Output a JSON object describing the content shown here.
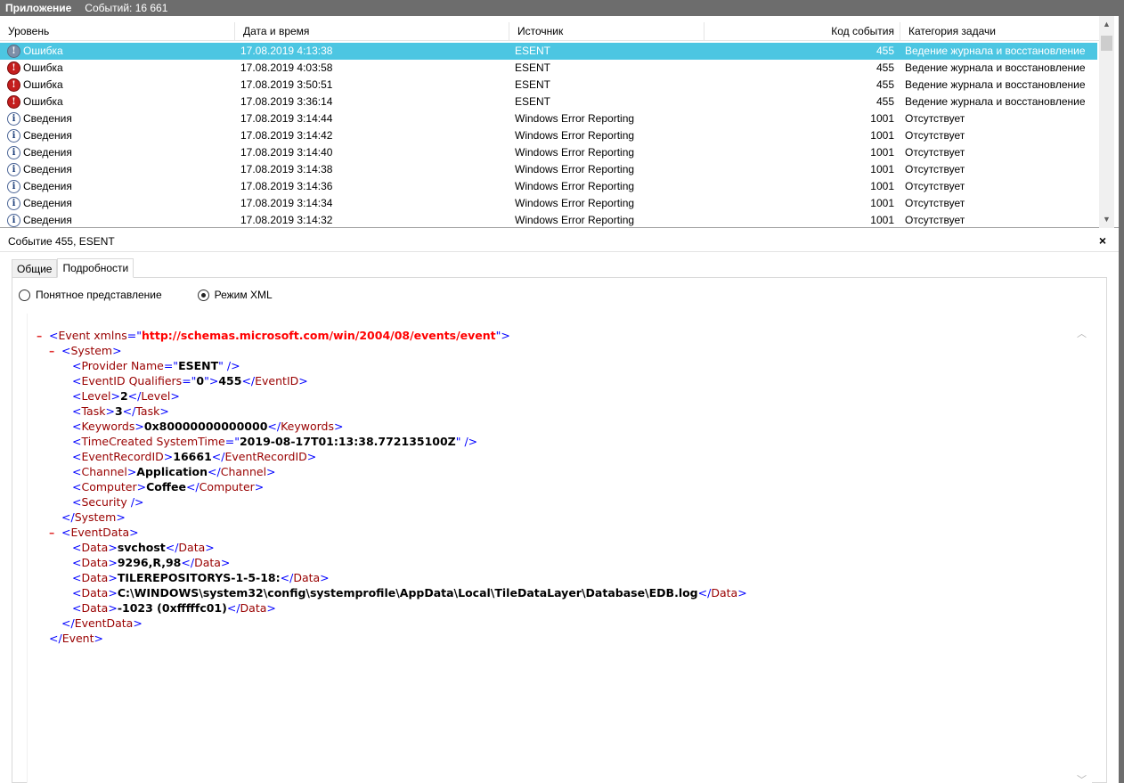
{
  "titlebar": {
    "app": "Приложение",
    "events": "Событий: 16 661"
  },
  "list": {
    "columns": {
      "level": "Уровень",
      "date": "Дата и время",
      "source": "Источник",
      "code": "Код события",
      "category": "Категория задачи"
    },
    "rows": [
      {
        "level": "Ошибка",
        "date": "17.08.2019 4:13:38",
        "source": "ESENT",
        "code": "455",
        "category": "Ведение журнала и восстановление"
      },
      {
        "level": "Ошибка",
        "date": "17.08.2019 4:03:58",
        "source": "ESENT",
        "code": "455",
        "category": "Ведение журнала и восстановление"
      },
      {
        "level": "Ошибка",
        "date": "17.08.2019 3:50:51",
        "source": "ESENT",
        "code": "455",
        "category": "Ведение журнала и восстановление"
      },
      {
        "level": "Ошибка",
        "date": "17.08.2019 3:36:14",
        "source": "ESENT",
        "code": "455",
        "category": "Ведение журнала и восстановление"
      },
      {
        "level": "Сведения",
        "date": "17.08.2019 3:14:44",
        "source": "Windows Error Reporting",
        "code": "1001",
        "category": "Отсутствует"
      },
      {
        "level": "Сведения",
        "date": "17.08.2019 3:14:42",
        "source": "Windows Error Reporting",
        "code": "1001",
        "category": "Отсутствует"
      },
      {
        "level": "Сведения",
        "date": "17.08.2019 3:14:40",
        "source": "Windows Error Reporting",
        "code": "1001",
        "category": "Отсутствует"
      },
      {
        "level": "Сведения",
        "date": "17.08.2019 3:14:38",
        "source": "Windows Error Reporting",
        "code": "1001",
        "category": "Отсутствует"
      },
      {
        "level": "Сведения",
        "date": "17.08.2019 3:14:36",
        "source": "Windows Error Reporting",
        "code": "1001",
        "category": "Отсутствует"
      },
      {
        "level": "Сведения",
        "date": "17.08.2019 3:14:34",
        "source": "Windows Error Reporting",
        "code": "1001",
        "category": "Отсутствует"
      },
      {
        "level": "Сведения",
        "date": "17.08.2019 3:14:32",
        "source": "Windows Error Reporting",
        "code": "1001",
        "category": "Отсутствует"
      }
    ]
  },
  "detail": {
    "title": "Событие 455, ESENT",
    "close": "×"
  },
  "tabs": {
    "general": "Общие",
    "details": "Подробности"
  },
  "view": {
    "friendly": "Понятное представление",
    "xml": "Режим XML"
  },
  "xml": {
    "event_ns": "http://schemas.microsoft.com/win/2004/08/events/event",
    "provider_name": "ESENT",
    "qualifiers": "0",
    "event_id": "455",
    "level": "2",
    "task": "3",
    "keywords": "0x80000000000000",
    "system_time": "2019-08-17T01:13:38.772135100Z",
    "record_id": "16661",
    "channel": "Application",
    "computer": "Coffee",
    "data": [
      "svchost",
      "9296,R,98",
      "TILEREPOSITORYS-1-5-18:",
      "C:\\WINDOWS\\system32\\config\\systemprofile\\AppData\\Local\\TileDataLayer\\Database\\EDB.log",
      "-1023 (0xfffffc01)"
    ]
  }
}
